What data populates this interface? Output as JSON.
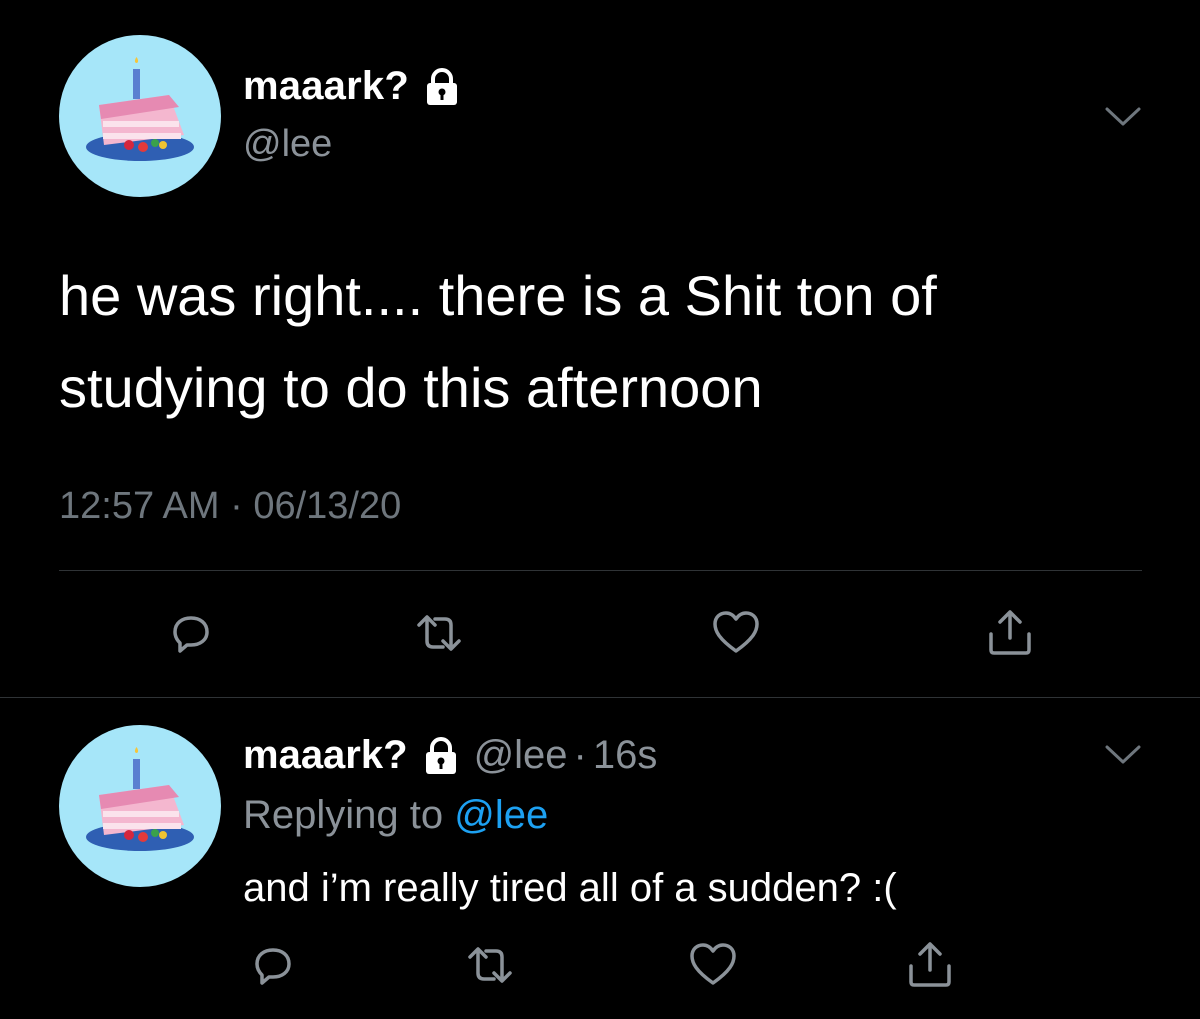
{
  "main_tweet": {
    "display_name": "maaark?",
    "handle": "@lee",
    "text": "he was right.... there is a Shit ton of studying to do this afternoon",
    "meta": "12:57 AM · 06/13/20",
    "avatar_icon": "cake-slice-avatar",
    "locked_icon": "lock-icon",
    "actions": [
      "reply-icon",
      "retweet-icon",
      "like-icon",
      "share-icon"
    ]
  },
  "reply_tweet": {
    "display_name": "maaark?",
    "handle": "@lee",
    "separator": "·",
    "time": "16s",
    "replying_prefix": "Replying to",
    "replying_to": "@lee",
    "text": "and i’m really tired all of a sudden? :(",
    "avatar_icon": "cake-slice-avatar",
    "locked_icon": "lock-icon",
    "actions": [
      "reply-icon",
      "retweet-icon",
      "like-icon",
      "share-icon"
    ]
  },
  "colors": {
    "background": "#000000",
    "primary_text": "#ffffff",
    "secondary_text": "#8b9299",
    "link": "#1da1f2",
    "divider": "#2f3336",
    "avatar_bg": "#a6e6f9"
  }
}
